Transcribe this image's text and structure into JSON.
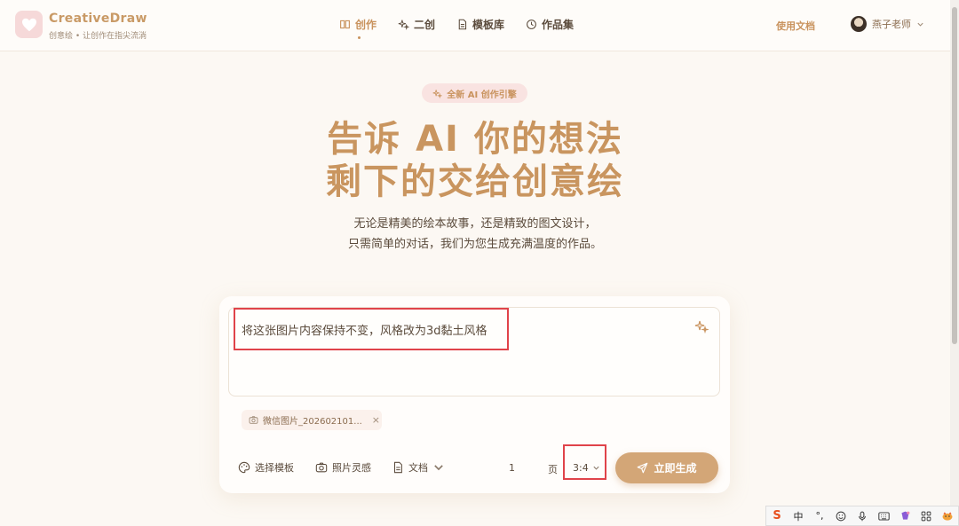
{
  "brand": {
    "name": "CreativeDraw",
    "tagline": "创意绘 • 让创作在指尖流淌"
  },
  "nav": {
    "items": [
      {
        "label": "创作",
        "icon": "book-icon",
        "active": true
      },
      {
        "label": "二创",
        "icon": "sparkle-icon",
        "active": false
      },
      {
        "label": "模板库",
        "icon": "document-icon",
        "active": false
      },
      {
        "label": "作品集",
        "icon": "history-icon",
        "active": false
      }
    ],
    "docs_label": "使用文档",
    "user_name": "燕子老师"
  },
  "hero": {
    "badge": "全新 AI 创作引擎",
    "title_line1": "告诉 AI 你的想法",
    "title_line2": "剩下的交给创意绘",
    "sub_line1": "无论是精美的绘本故事，还是精致的图文设计，",
    "sub_line2": "只需简单的对话，我们为您生成充满温度的作品。"
  },
  "composer": {
    "prompt_value": "将这张图片内容保持不变，风格改为3d黏土风格",
    "attachment_name": "微信图片_202602101...",
    "attachment_close": "×",
    "template_label": "选择模板",
    "photo_label": "照片灵感",
    "doc_label": "文档",
    "page_count": "1",
    "page_unit": "页",
    "ratio": "3:4",
    "generate_label": "立即生成"
  },
  "ime": {
    "mode": "中",
    "punct": "°,"
  },
  "colors": {
    "accent": "#c9935e",
    "button": "#d3a677",
    "background": "#fcf8f3",
    "highlight": "#e0434a"
  }
}
